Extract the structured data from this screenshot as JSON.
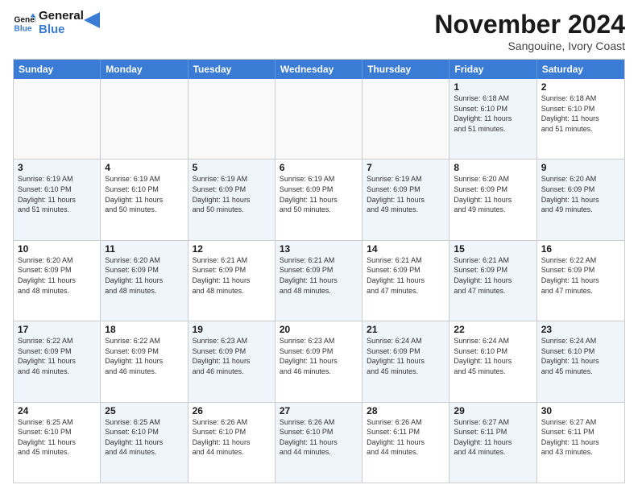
{
  "logo": {
    "line1": "General",
    "line2": "Blue"
  },
  "title": "November 2024",
  "location": "Sangouine, Ivory Coast",
  "weekdays": [
    "Sunday",
    "Monday",
    "Tuesday",
    "Wednesday",
    "Thursday",
    "Friday",
    "Saturday"
  ],
  "rows": [
    [
      {
        "day": "",
        "info": ""
      },
      {
        "day": "",
        "info": ""
      },
      {
        "day": "",
        "info": ""
      },
      {
        "day": "",
        "info": ""
      },
      {
        "day": "",
        "info": ""
      },
      {
        "day": "1",
        "info": "Sunrise: 6:18 AM\nSunset: 6:10 PM\nDaylight: 11 hours\nand 51 minutes."
      },
      {
        "day": "2",
        "info": "Sunrise: 6:18 AM\nSunset: 6:10 PM\nDaylight: 11 hours\nand 51 minutes."
      }
    ],
    [
      {
        "day": "3",
        "info": "Sunrise: 6:19 AM\nSunset: 6:10 PM\nDaylight: 11 hours\nand 51 minutes."
      },
      {
        "day": "4",
        "info": "Sunrise: 6:19 AM\nSunset: 6:10 PM\nDaylight: 11 hours\nand 50 minutes."
      },
      {
        "day": "5",
        "info": "Sunrise: 6:19 AM\nSunset: 6:09 PM\nDaylight: 11 hours\nand 50 minutes."
      },
      {
        "day": "6",
        "info": "Sunrise: 6:19 AM\nSunset: 6:09 PM\nDaylight: 11 hours\nand 50 minutes."
      },
      {
        "day": "7",
        "info": "Sunrise: 6:19 AM\nSunset: 6:09 PM\nDaylight: 11 hours\nand 49 minutes."
      },
      {
        "day": "8",
        "info": "Sunrise: 6:20 AM\nSunset: 6:09 PM\nDaylight: 11 hours\nand 49 minutes."
      },
      {
        "day": "9",
        "info": "Sunrise: 6:20 AM\nSunset: 6:09 PM\nDaylight: 11 hours\nand 49 minutes."
      }
    ],
    [
      {
        "day": "10",
        "info": "Sunrise: 6:20 AM\nSunset: 6:09 PM\nDaylight: 11 hours\nand 48 minutes."
      },
      {
        "day": "11",
        "info": "Sunrise: 6:20 AM\nSunset: 6:09 PM\nDaylight: 11 hours\nand 48 minutes."
      },
      {
        "day": "12",
        "info": "Sunrise: 6:21 AM\nSunset: 6:09 PM\nDaylight: 11 hours\nand 48 minutes."
      },
      {
        "day": "13",
        "info": "Sunrise: 6:21 AM\nSunset: 6:09 PM\nDaylight: 11 hours\nand 48 minutes."
      },
      {
        "day": "14",
        "info": "Sunrise: 6:21 AM\nSunset: 6:09 PM\nDaylight: 11 hours\nand 47 minutes."
      },
      {
        "day": "15",
        "info": "Sunrise: 6:21 AM\nSunset: 6:09 PM\nDaylight: 11 hours\nand 47 minutes."
      },
      {
        "day": "16",
        "info": "Sunrise: 6:22 AM\nSunset: 6:09 PM\nDaylight: 11 hours\nand 47 minutes."
      }
    ],
    [
      {
        "day": "17",
        "info": "Sunrise: 6:22 AM\nSunset: 6:09 PM\nDaylight: 11 hours\nand 46 minutes."
      },
      {
        "day": "18",
        "info": "Sunrise: 6:22 AM\nSunset: 6:09 PM\nDaylight: 11 hours\nand 46 minutes."
      },
      {
        "day": "19",
        "info": "Sunrise: 6:23 AM\nSunset: 6:09 PM\nDaylight: 11 hours\nand 46 minutes."
      },
      {
        "day": "20",
        "info": "Sunrise: 6:23 AM\nSunset: 6:09 PM\nDaylight: 11 hours\nand 46 minutes."
      },
      {
        "day": "21",
        "info": "Sunrise: 6:24 AM\nSunset: 6:09 PM\nDaylight: 11 hours\nand 45 minutes."
      },
      {
        "day": "22",
        "info": "Sunrise: 6:24 AM\nSunset: 6:10 PM\nDaylight: 11 hours\nand 45 minutes."
      },
      {
        "day": "23",
        "info": "Sunrise: 6:24 AM\nSunset: 6:10 PM\nDaylight: 11 hours\nand 45 minutes."
      }
    ],
    [
      {
        "day": "24",
        "info": "Sunrise: 6:25 AM\nSunset: 6:10 PM\nDaylight: 11 hours\nand 45 minutes."
      },
      {
        "day": "25",
        "info": "Sunrise: 6:25 AM\nSunset: 6:10 PM\nDaylight: 11 hours\nand 44 minutes."
      },
      {
        "day": "26",
        "info": "Sunrise: 6:26 AM\nSunset: 6:10 PM\nDaylight: 11 hours\nand 44 minutes."
      },
      {
        "day": "27",
        "info": "Sunrise: 6:26 AM\nSunset: 6:10 PM\nDaylight: 11 hours\nand 44 minutes."
      },
      {
        "day": "28",
        "info": "Sunrise: 6:26 AM\nSunset: 6:11 PM\nDaylight: 11 hours\nand 44 minutes."
      },
      {
        "day": "29",
        "info": "Sunrise: 6:27 AM\nSunset: 6:11 PM\nDaylight: 11 hours\nand 44 minutes."
      },
      {
        "day": "30",
        "info": "Sunrise: 6:27 AM\nSunset: 6:11 PM\nDaylight: 11 hours\nand 43 minutes."
      }
    ]
  ]
}
